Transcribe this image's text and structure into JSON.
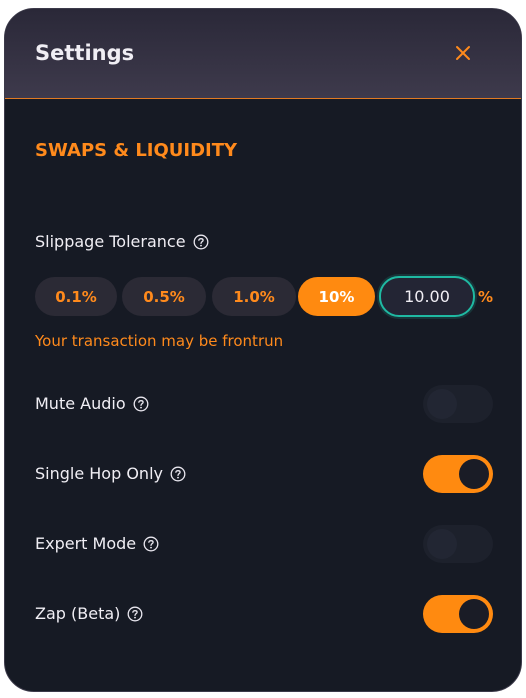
{
  "header": {
    "title": "Settings",
    "close_icon": "close-icon"
  },
  "section": {
    "title": "SWAPS & LIQUIDITY"
  },
  "slippage": {
    "label": "Slippage Tolerance",
    "options": [
      "0.1%",
      "0.5%",
      "1.0%",
      "10%"
    ],
    "selected": "10%",
    "custom_value": "10.00",
    "unit": "%",
    "warning": "Your transaction may be frontrun"
  },
  "toggles": [
    {
      "label": "Mute Audio",
      "enabled": false
    },
    {
      "label": "Single Hop Only",
      "enabled": true
    },
    {
      "label": "Expert Mode",
      "enabled": false
    },
    {
      "label": "Zap (Beta)",
      "enabled": true
    }
  ],
  "colors": {
    "accent": "#ff8a10",
    "input_border": "#1fb9a2",
    "background": "#161a24"
  }
}
